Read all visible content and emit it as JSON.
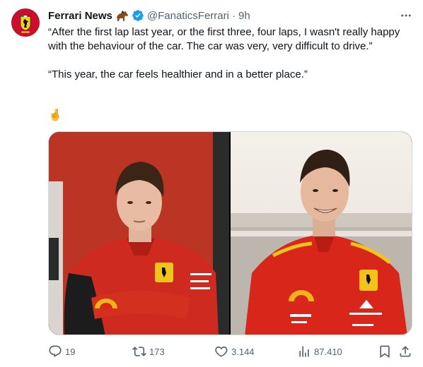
{
  "author": {
    "name": "Ferrari News",
    "handle": "@FanaticsFerrari",
    "separator": "·",
    "time": "9h",
    "name_emoji_icon": "horse-icon",
    "verified_badge_color": "#1d9bf0",
    "avatar_icon": "ferrari-shield-icon",
    "avatar_color": "#c8102e"
  },
  "tweet": {
    "paragraph_1": "“After the first lap last year, or the first three, four laps, I wasn't really happy with the behaviour of the car. The car was very, very difficult to drive.”",
    "paragraph_2": "“This year, the car feels healthier and in a better place.”",
    "emoji": "🤞"
  },
  "media": {
    "left_photo_icon": "driver-portrait-red-background",
    "right_photo_icon": "driver-portrait-smiling-outdoor"
  },
  "actions": {
    "replies": "19",
    "reposts": "173",
    "likes": "3.144",
    "views": "87.410",
    "reply_icon": "reply-icon",
    "repost_icon": "repost-icon",
    "like_icon": "heart-icon",
    "views_icon": "views-chart-icon",
    "bookmark_icon": "bookmark-icon",
    "share_icon": "share-icon"
  },
  "colors": {
    "text": "#0f1419",
    "secondary": "#536471",
    "border": "#cfd9de",
    "ferrari_red": "#c8102e"
  }
}
